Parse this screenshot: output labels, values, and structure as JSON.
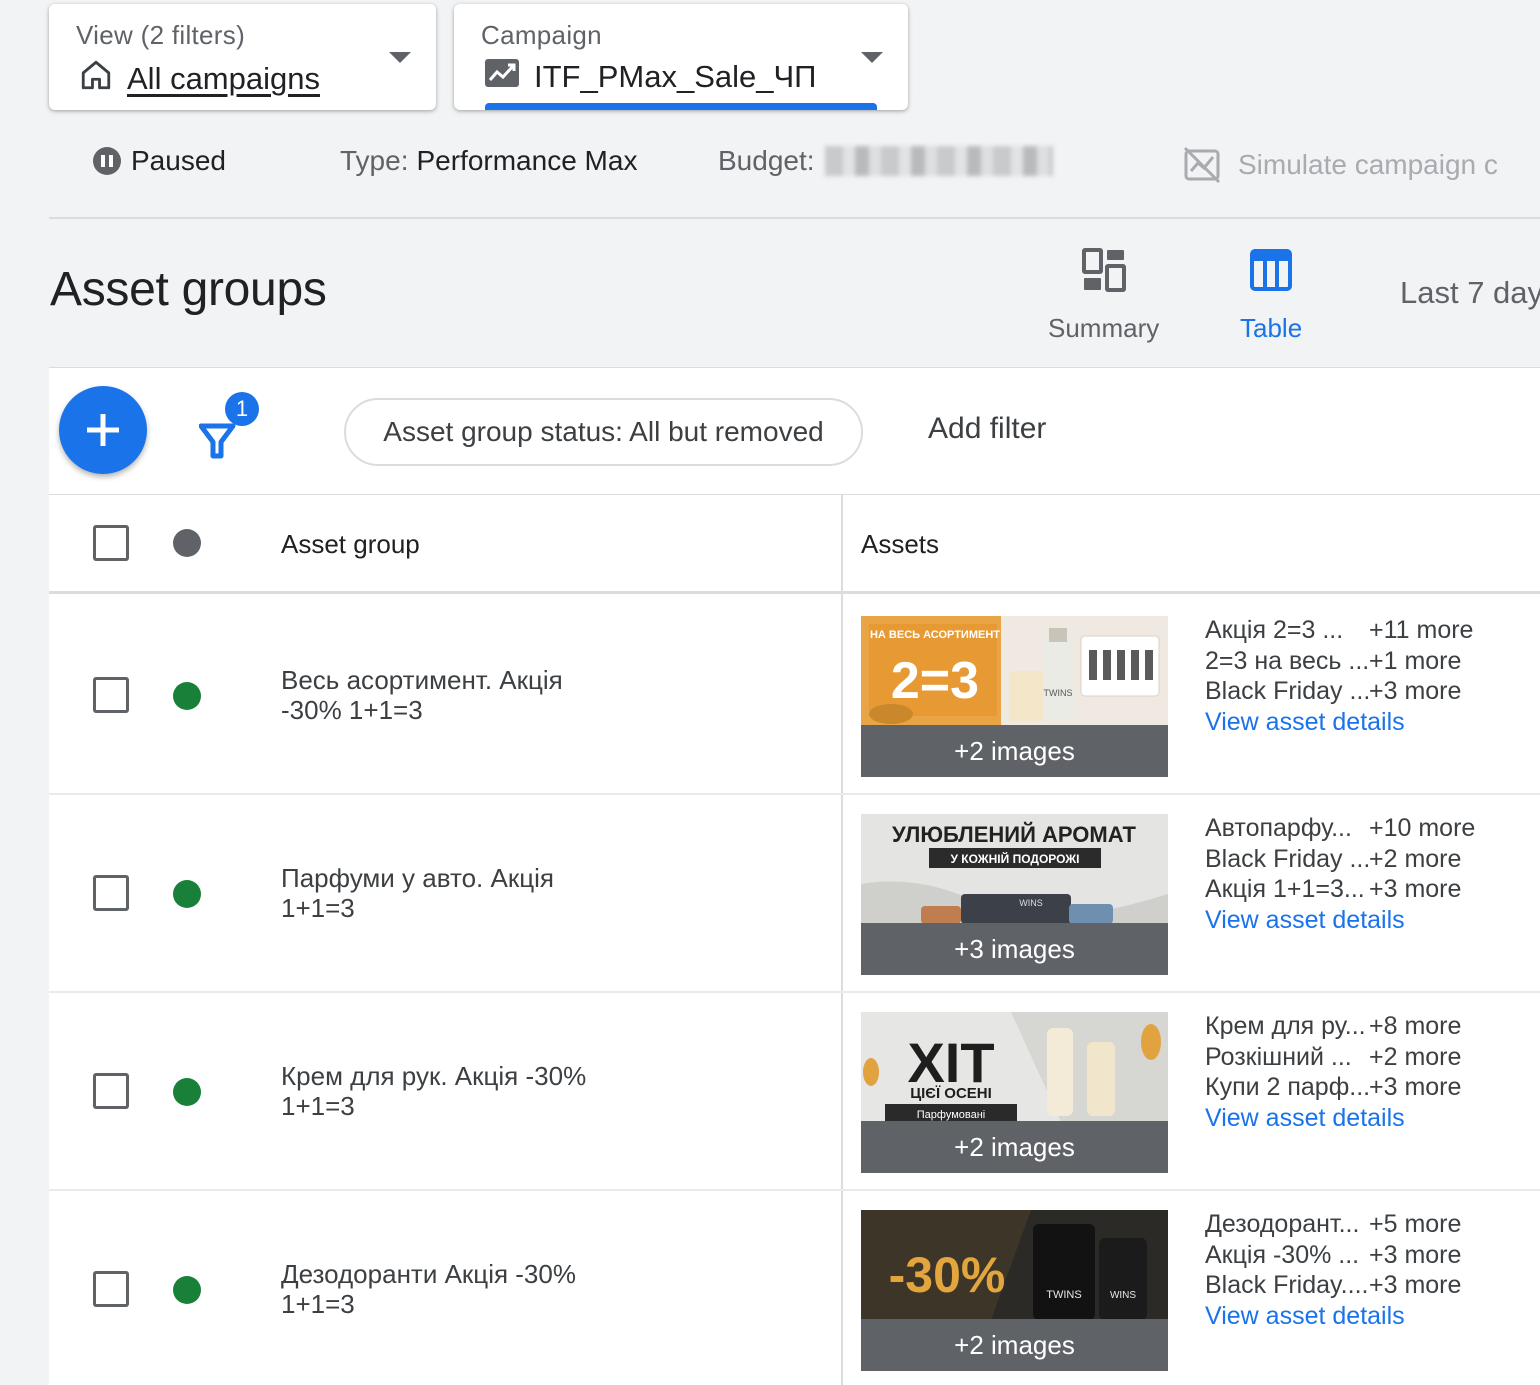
{
  "view_selector": {
    "label": "View (2 filters)",
    "value": "All campaigns"
  },
  "campaign_selector": {
    "label": "Campaign",
    "value": "ITF_PMax_Sale_ЧП"
  },
  "campaign_info": {
    "status": "Paused",
    "type_label": "Type:",
    "type_value": "Performance Max",
    "budget_label": "Budget:",
    "simulate": "Simulate campaign c"
  },
  "page_title": "Asset groups",
  "view_tabs": {
    "summary": "Summary",
    "table": "Table"
  },
  "date_range": "Last 7 day",
  "toolbar": {
    "filter_badge": "1",
    "status_chip": "Asset group status: All but removed",
    "add_filter": "Add filter"
  },
  "table": {
    "headers": {
      "asset_group": "Asset group",
      "assets": "Assets"
    },
    "rows": [
      {
        "name": "Весь асортимент. Акція -30% 1+1=3",
        "images_more": "+2 images",
        "thumb_text_1": "НА ВЕСЬ АСОРТИМЕНТ",
        "thumb_text_2": "2=3",
        "thumb_text_3": "TWINS",
        "assets": [
          {
            "text": "Акція 2=3 ...",
            "more": "+11 more"
          },
          {
            "text": "2=3 на весь ...",
            "more": "+1 more"
          },
          {
            "text": "Black Friday ...",
            "more": "+3 more"
          }
        ],
        "link": "View asset details"
      },
      {
        "name": "Парфуми у авто. Акція 1+1=3",
        "images_more": "+3 images",
        "thumb_text_1": "УЛЮБЛЕНИЙ АРОМАТ",
        "thumb_text_2": "У КОЖНІЙ ПОДОРОЖІ",
        "thumb_text_3": "WINS",
        "assets": [
          {
            "text": "Автопарфу...",
            "more": "+10 more"
          },
          {
            "text": "Black Friday ...",
            "more": "+2 more"
          },
          {
            "text": "Акція 1+1=3...",
            "more": "+3 more"
          }
        ],
        "link": "View asset details"
      },
      {
        "name": "Крем для рук. Акція -30% 1+1=3",
        "images_more": "+2 images",
        "thumb_text_1": "ХІТ",
        "thumb_text_2": "ЦІЄЇ ОСЕНІ",
        "thumb_text_3": "Парфумовані",
        "assets": [
          {
            "text": "Крем для ру...",
            "more": "+8 more"
          },
          {
            "text": "Розкішний ...",
            "more": "+2 more"
          },
          {
            "text": "Купи 2 парф...",
            "more": "+3 more"
          }
        ],
        "link": "View asset details"
      },
      {
        "name": "Дезодоранти Акція -30% 1+1=3",
        "images_more": "+2 images",
        "thumb_text_1": "-30%",
        "thumb_text_2": "TWINS",
        "thumb_text_3": "WINS",
        "assets": [
          {
            "text": "Дезодорант...",
            "more": "+5 more"
          },
          {
            "text": "Акція -30% ...",
            "more": "+3 more"
          },
          {
            "text": "Black Friday....",
            "more": "+3 more"
          }
        ],
        "link": "View asset details"
      }
    ]
  },
  "colors": {
    "accent": "#1a73e8",
    "enabled": "#188038",
    "paused": "#5f6368"
  }
}
